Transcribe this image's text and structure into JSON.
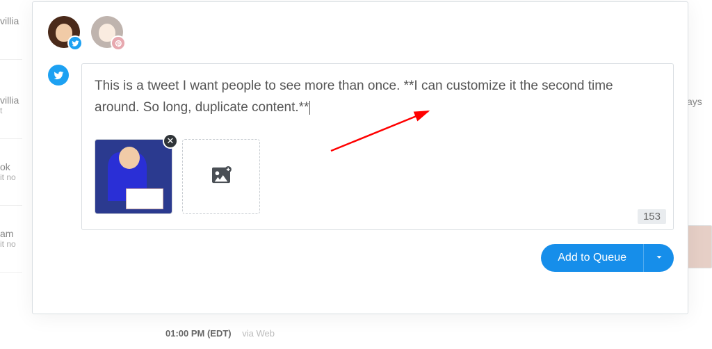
{
  "bg": {
    "items": [
      {
        "name": "villia",
        "sub": ""
      },
      {
        "name": "villia",
        "sub": "t"
      },
      {
        "name": "ok",
        "sub": "it no"
      },
      {
        "name": "am",
        "sub": "it no"
      }
    ],
    "right_text": "ays",
    "time": "01:00 PM (EDT)",
    "via": "via Web"
  },
  "accounts": [
    {
      "network": "twitter",
      "active": true
    },
    {
      "network": "pinterest",
      "active": false
    }
  ],
  "compose": {
    "network": "twitter",
    "text": "This is a tweet I want people to see more than once. **I can customize it the second time around. So long, duplicate content.**",
    "char_counter": "153"
  },
  "media": {
    "attached": 1,
    "add_label": "add-image"
  },
  "actions": {
    "queue_label": "Add to Queue"
  },
  "icons": {
    "twitter": "twitter-icon",
    "pinterest": "pinterest-icon",
    "close": "close-icon",
    "add_image": "add-image-icon",
    "chevron_down": "chevron-down-icon"
  }
}
